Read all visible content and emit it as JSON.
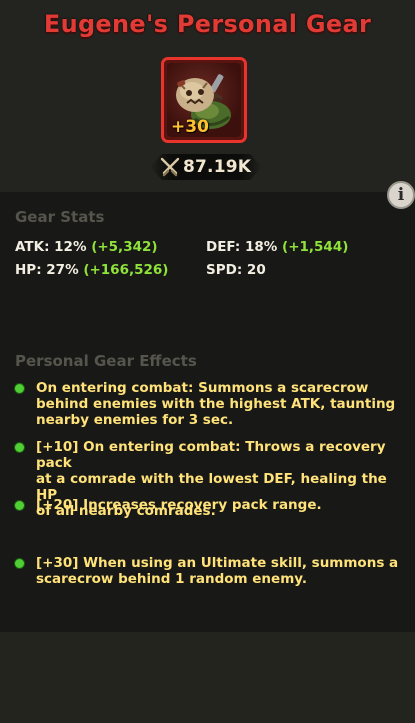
{
  "header": {
    "title": "Eugene's Personal Gear",
    "gear_level": "+30",
    "power_value": "87.19K",
    "colors": {
      "title": "#e23a34",
      "frame": "#e8342c",
      "level": "#ffc12e"
    }
  },
  "stats": {
    "section_title": "Gear Stats",
    "atk": {
      "label": "ATK: 12% ",
      "bonus": "(+5,342)"
    },
    "def": {
      "label": "DEF: 18% ",
      "bonus": "(+1,544)"
    },
    "hp": {
      "label": "HP: 27% ",
      "bonus": "(+166,526)"
    },
    "spd": {
      "label": "SPD: 20"
    },
    "bonus_color": "#8fe23a"
  },
  "effects": {
    "section_title": "Personal Gear Effects",
    "items": [
      "On entering combat: Summons a scarecrow\nbehind enemies with the highest ATK, taunting\nnearby enemies for 3 sec.",
      "[+10] On entering combat: Throws a recovery pack\nat a comrade with the lowest DEF, healing the HP\nof all nearby comrades.",
      "[+20] Increases recovery pack range.",
      "[+30] When using an Ultimate skill, summons a\nscarecrow behind 1 random enemy."
    ],
    "text_color": "#ffe27a",
    "bullet_color": "#4fcf33"
  },
  "icons": {
    "info": "info-icon",
    "power": "crossed-swords-icon",
    "gear": "scarecrow-gear-icon"
  }
}
